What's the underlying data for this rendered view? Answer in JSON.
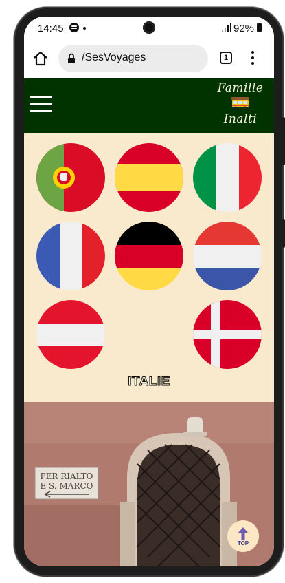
{
  "status_bar": {
    "time": "14:45",
    "battery": "92%"
  },
  "browser": {
    "url": "/SesVoyages",
    "tab_count": "1"
  },
  "header": {
    "logo_top": "Famille",
    "logo_bottom": "Inalti"
  },
  "flags": [
    {
      "country": "portugal-flag"
    },
    {
      "country": "spain-flag"
    },
    {
      "country": "italy-flag"
    },
    {
      "country": "france-flag"
    },
    {
      "country": "germany-flag"
    },
    {
      "country": "netherlands-flag"
    },
    {
      "country": "austria-flag"
    },
    {
      "country": "denmark-flag"
    }
  ],
  "country_title": "ITALIE",
  "photo": {
    "sign_line1": "PER RIALTO",
    "sign_line2": "E S. MARCO"
  },
  "top_button": {
    "label": "TOP"
  },
  "colors": {
    "header_bg": "#003300",
    "panel_bg": "#faeacd"
  }
}
